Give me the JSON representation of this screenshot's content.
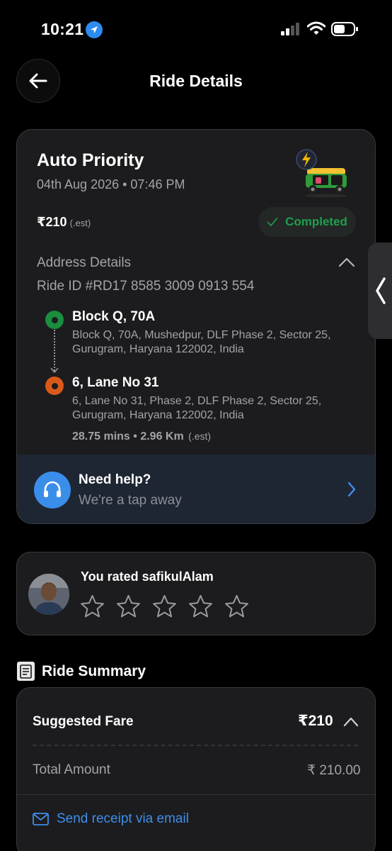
{
  "status_bar": {
    "time": "10:21"
  },
  "header": {
    "title": "Ride Details"
  },
  "ride": {
    "type": "Auto Priority",
    "datetime": "04th Aug 2026 • 07:46 PM",
    "price": "₹210",
    "price_note": "(.est)",
    "status": "Completed",
    "status_color": "#1f9e4c",
    "address_section_title": "Address Details",
    "ride_id": "Ride ID #RD17 8585 3009 0913 554",
    "pickup": {
      "name": "Block Q, 70A",
      "address": "Block Q, 70A, Mushedpur, DLF Phase 2, Sector 25, Gurugram, Haryana 122002, India"
    },
    "drop": {
      "name": "6, Lane No 31",
      "address": "6, Lane No 31, Phase 2, DLF Phase 2, Sector 25, Gurugram, Haryana 122002, India"
    },
    "trip_meta": "28.75 mins • 2.96 Km",
    "trip_meta_note": "(.est)"
  },
  "help": {
    "title": "Need help?",
    "subtitle": "We're a tap away"
  },
  "rating": {
    "text": "You rated safikulAlam",
    "stars_filled": 0,
    "stars_total": 5
  },
  "summary": {
    "title": "Ride Summary",
    "fare_label": "Suggested Fare",
    "fare_value": "₹210",
    "total_label": "Total Amount",
    "total_value": "₹ 210.00",
    "email_link": "Send receipt via email"
  },
  "colors": {
    "accent_blue": "#3d8eec",
    "pickup_green": "#1a8d3e",
    "drop_orange": "#d9591a"
  }
}
